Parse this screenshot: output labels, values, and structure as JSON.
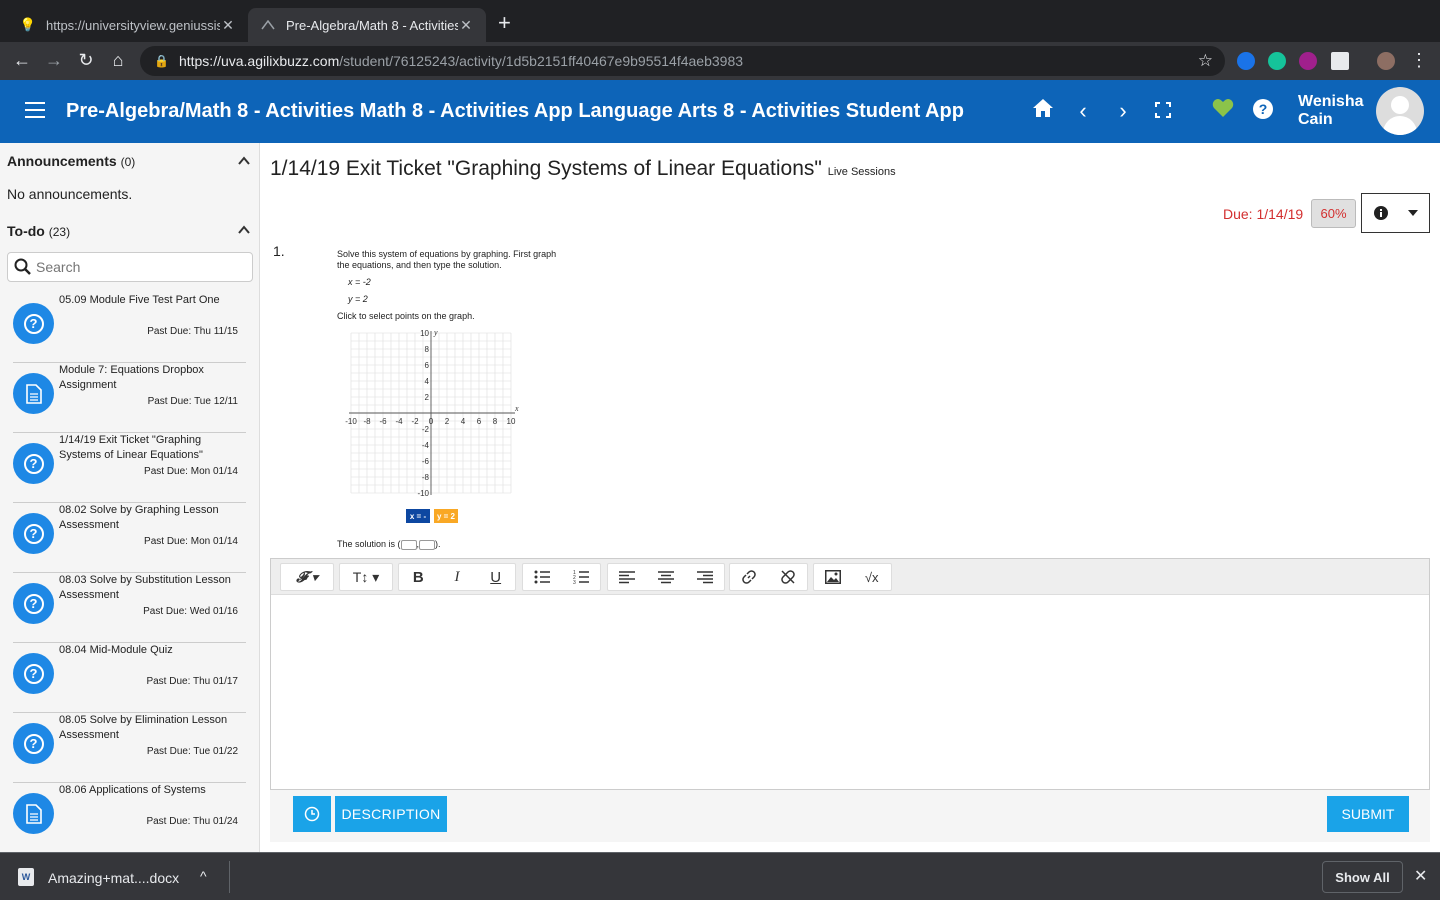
{
  "browser": {
    "tabs": [
      {
        "title": "https://universityview.geniussis",
        "favicon": "lightbulb-icon"
      },
      {
        "title": "Pre-Algebra/Math 8 - Activities",
        "favicon": "app-icon"
      }
    ],
    "url_host": "https://uva.agilixbuzz.com",
    "url_path": "/student/76125243/activity/1d5b2151ff40467e9b95514f4aeb3983"
  },
  "header": {
    "title": "Pre-Algebra/Math 8 - Activities Math 8 - Activities App Language Arts 8 - Activities Student App",
    "user_first": "Wenisha",
    "user_last": "Cain"
  },
  "sidebar": {
    "announcements_label": "Announcements",
    "announcements_count": "(0)",
    "no_announcements": "No announcements.",
    "todo_label": "To-do",
    "todo_count": "(23)",
    "search_placeholder": "Search",
    "items": [
      {
        "title": "05.09 Module Five Test Part One",
        "due": "Past Due: Thu 11/15",
        "icon": "question-icon"
      },
      {
        "title": "Module 7: Equations Dropbox Assignment",
        "due": "Past Due: Tue 12/11",
        "icon": "document-icon"
      },
      {
        "title": "1/14/19 Exit Ticket \"Graphing Systems of Linear Equations\"",
        "due": "Past Due: Mon 01/14",
        "icon": "question-icon"
      },
      {
        "title": "08.02 Solve by Graphing Lesson Assessment",
        "due": "Past Due: Mon 01/14",
        "icon": "question-icon"
      },
      {
        "title": "08.03 Solve by Substitution Lesson Assessment",
        "due": "Past Due: Wed 01/16",
        "icon": "question-icon"
      },
      {
        "title": "08.04 Mid-Module Quiz",
        "due": "Past Due: Thu 01/17",
        "icon": "question-icon"
      },
      {
        "title": "08.05 Solve by Elimination Lesson Assessment",
        "due": "Past Due: Tue 01/22",
        "icon": "question-icon"
      },
      {
        "title": "08.06 Applications of Systems",
        "due": "Past Due: Thu 01/24",
        "icon": "document-icon"
      }
    ]
  },
  "main": {
    "title": "1/14/19 Exit Ticket \"Graphing Systems of Linear Equations\"",
    "title_suffix": "Live Sessions",
    "due": "Due: 1/14/19",
    "score": "60%",
    "question_number": "1.",
    "question": {
      "instruction_1": "Solve this system of equations by graphing. First graph",
      "instruction_2": "the equations, and then type the solution.",
      "eq1": "x = -2",
      "eq2": "y = 2",
      "prompt": "Click to select points on the graph.",
      "legend_x": "x = -",
      "legend_y": "y = 2",
      "solution_prefix": "The solution is (",
      "solution_suffix": ")."
    },
    "graph": {
      "x_ticks": [
        "-10",
        "-8",
        "-6",
        "-4",
        "-2",
        "0",
        "2",
        "4",
        "6",
        "8",
        "10"
      ],
      "y_ticks_pos": [
        "10",
        "8",
        "6",
        "4",
        "2"
      ],
      "y_ticks_neg": [
        "-2",
        "-4",
        "-6",
        "-8",
        "-10"
      ],
      "x_label": "x",
      "y_label": "y"
    },
    "buttons": {
      "description": "DESCRIPTION",
      "submit": "SUBMIT"
    }
  },
  "download": {
    "filename": "Amazing+mat....docx",
    "show_all": "Show All"
  }
}
